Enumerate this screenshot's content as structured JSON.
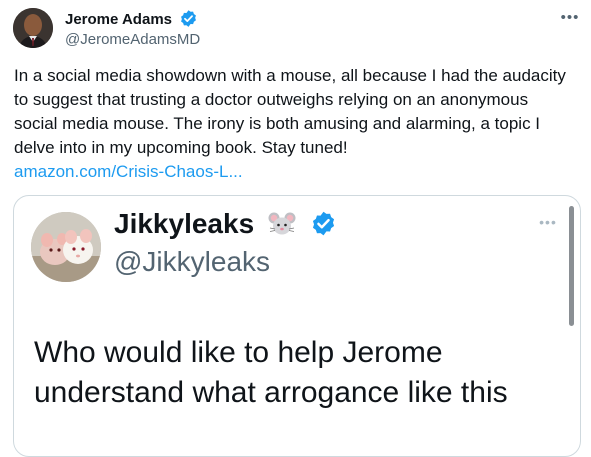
{
  "tweet": {
    "author": {
      "name": "Jerome Adams",
      "handle": "@JeromeAdamsMD",
      "verified": true
    },
    "more_icon": "more-horizontal-icon",
    "text": "In a social media showdown with a mouse, all because I had the audacity to suggest that trusting a doctor outweighs relying on an anonymous social media mouse. The irony is both amusing and alarming, a topic I delve into in my upcoming book. Stay tuned!",
    "link": "amazon.com/Crisis-Chaos-L..."
  },
  "quoted": {
    "author": {
      "name": "Jikkyleaks",
      "emoji": "🐭",
      "handle": "@Jikkyleaks",
      "verified": true
    },
    "text": "Who would like to help Jerome understand what arrogance like this"
  },
  "colors": {
    "link": "#1d9bf0",
    "verified": "#1d9bf0",
    "secondary_text": "#536471",
    "border": "#cfd9de"
  }
}
